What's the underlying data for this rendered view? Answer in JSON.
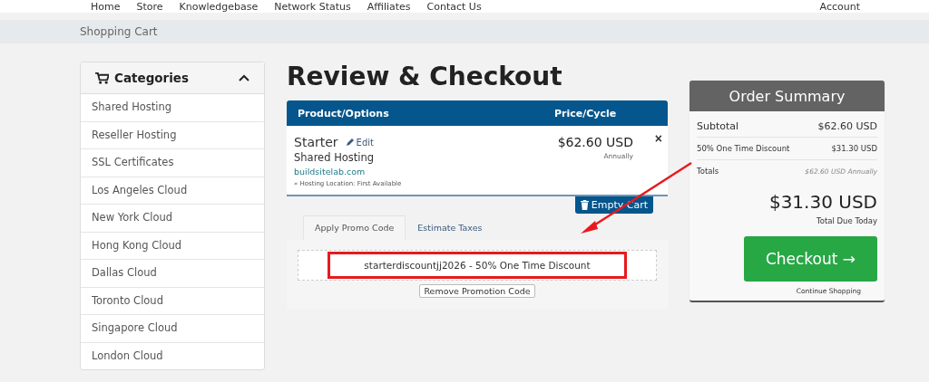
{
  "nav": {
    "items": [
      "Home",
      "Store",
      "Knowledgebase",
      "Network Status",
      "Affiliates",
      "Contact Us"
    ],
    "account": "Account"
  },
  "breadcrumb": "Shopping Cart",
  "sidebar": {
    "title": "Categories",
    "expanded": true,
    "items": [
      "Shared Hosting",
      "Reseller Hosting",
      "SSL Certificates",
      "Los Angeles Cloud",
      "New York Cloud",
      "Hong Kong Cloud",
      "Dallas Cloud",
      "Toronto Cloud",
      "Singapore Cloud",
      "London Cloud"
    ]
  },
  "page_title": "Review & Checkout",
  "cart": {
    "columns": [
      "Product/Options",
      "Price/Cycle"
    ],
    "item": {
      "name": "Starter",
      "edit": "Edit",
      "group": "Shared Hosting",
      "domain": "buildsitelab.com",
      "option": "» Hosting Location: First Available",
      "price": "$62.60 USD",
      "cycle": "Annually",
      "remove": "×"
    },
    "empty_button": "Empty Cart"
  },
  "promo_tabs": [
    {
      "label": "Apply Promo Code",
      "selected": true
    },
    {
      "label": "Estimate Taxes",
      "selected": false
    }
  ],
  "promo": {
    "applied": "starterdiscountjj2026 - 50% One Time Discount",
    "remove_button": "Remove Promotion Code"
  },
  "summary": {
    "title": "Order Summary",
    "rows": [
      {
        "label": "Subtotal",
        "value": "$62.60 USD",
        "kind": "main"
      },
      {
        "label": "50% One Time Discount",
        "value": "$31.30 USD",
        "kind": "small"
      },
      {
        "label": "Totals",
        "value": "$62.60 USD Annually",
        "kind": "total"
      }
    ],
    "total": "$31.30 USD",
    "total_label": "Total Due Today",
    "checkout": "Checkout",
    "checkout_arrow": "→",
    "continue": "Continue Shopping"
  }
}
